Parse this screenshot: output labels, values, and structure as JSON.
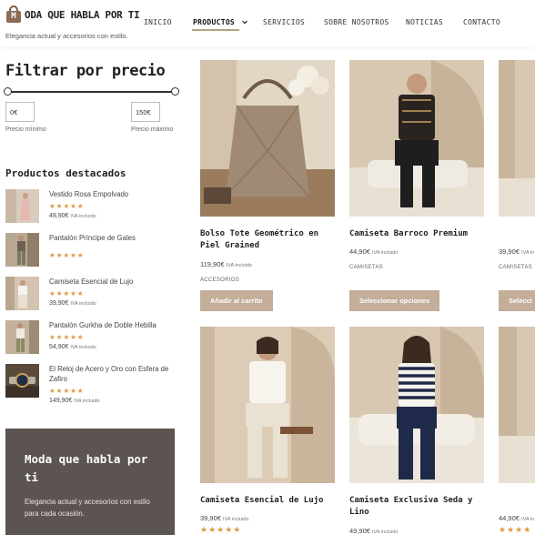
{
  "header": {
    "logo_letter": "M",
    "logo_text": "ODA QUE HABLA POR TI",
    "tagline": "Elegancia actual y accesorios con estilo.",
    "nav": [
      {
        "label": "INICIO"
      },
      {
        "label": "PRODUCTOS"
      },
      {
        "label": "SERVICIOS"
      },
      {
        "label": "SOBRE NOSOTROS"
      },
      {
        "label": "NOTICIAS"
      },
      {
        "label": "CONTACTO"
      }
    ],
    "nav_dropdown_icon": "chevron-down-icon"
  },
  "filter": {
    "title": "Filtrar por precio",
    "min_value": "0€",
    "max_value": "150€",
    "min_label": "Precio mínimo",
    "max_label": "Precio máximo"
  },
  "featured": {
    "title": "Productos destacados",
    "items": [
      {
        "name": "Vestido Rosa Empolvado",
        "stars": "★★★★★",
        "price": "49,90€",
        "tax": "IVA incluido"
      },
      {
        "name": "Pantalón Príncipe de Gales",
        "stars": "★★★★★",
        "price": "",
        "tax": ""
      },
      {
        "name": "Camiseta Esencial de Lujo",
        "stars": "★★★★★",
        "price": "39,90€",
        "tax": "IVA incluido"
      },
      {
        "name": "Pantalón Gurkha de Doble Hebilla",
        "stars": "★★★★★",
        "price": "54,90€",
        "tax": "IVA incluido"
      },
      {
        "name": "El Reloj de Acero y Oro con Esfera de Zafiro",
        "stars": "★★★★★",
        "price": "149,90€",
        "tax": "IVA incluido"
      }
    ]
  },
  "promo": {
    "title": "Moda que habla por ti",
    "text": "Elegancia actual y accesorios con estilo para cada ocasión."
  },
  "products": [
    {
      "name": "Bolso Tote Geométrico en Piel Grained",
      "price": "119,90€",
      "tax": "IVA incluido",
      "category": "ACCESORIOS",
      "button": "Añadir al carrito"
    },
    {
      "name": "Camiseta Barroco Premium",
      "price": "44,90€",
      "tax": "IVA incluido",
      "category": "CAMISETAS",
      "button": "Seleccionar opciones"
    },
    {
      "name": "",
      "price": "39,90€",
      "tax": "IVA in",
      "category": "CAMISETAS",
      "button": "Selecci"
    },
    {
      "name": "Camiseta Esencial de Lujo",
      "price": "39,90€",
      "tax": "IVA incluido",
      "stars": "★★★★★"
    },
    {
      "name": "Camiseta Exclusiva Seda y Lino",
      "price": "49,90€",
      "tax": "IVA incluido"
    },
    {
      "name": "",
      "price": "44,90€",
      "tax": "IVA in",
      "stars": "★★★★"
    }
  ],
  "colors": {
    "accent": "#c2ae99",
    "stars": "#e09a42",
    "promo_bg": "#5c5450"
  }
}
